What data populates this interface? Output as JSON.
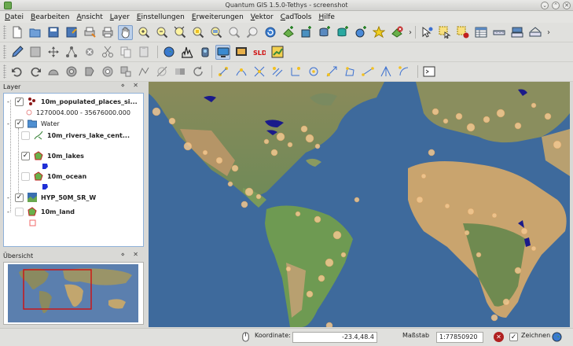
{
  "window": {
    "title": "Quantum GIS 1.5.0-Tethys - screenshot",
    "minimize_glyph": "⌄",
    "maximize_glyph": "⌃",
    "close_glyph": "✕",
    "close_button_label": "✕"
  },
  "menu": [
    {
      "label": "Datei"
    },
    {
      "label": "Bearbeiten"
    },
    {
      "label": "Ansicht"
    },
    {
      "label": "Layer"
    },
    {
      "label": "Einstellungen"
    },
    {
      "label": "Erweiterungen"
    },
    {
      "label": "Vektor"
    },
    {
      "label": "CadTools"
    },
    {
      "label": "Hilfe"
    }
  ],
  "toolbar_overflow": "›",
  "layers_panel": {
    "title": "Layer",
    "controls": "⋄ ✕",
    "items": [
      {
        "name": "10m_populated_places_si...",
        "checked": "✓",
        "icon": "point-layer-icon",
        "color": "#8b1a1a"
      },
      {
        "name": "1270004.000 - 35676000.000",
        "checked": "",
        "icon": "point-symbol-icon",
        "color": "#e89090"
      },
      {
        "name": "Water",
        "checked": "✓",
        "icon": "group-folder-icon",
        "color": "#4f8fd1"
      },
      {
        "name": "10m_rivers_lake_cent...",
        "checked": "",
        "icon": "line-layer-icon",
        "color": "#2a7a2a"
      },
      {
        "name": "10m_lakes",
        "checked": "✓",
        "icon": "polygon-layer-icon",
        "color": "#1f2fd6"
      },
      {
        "name": "10m_ocean",
        "checked": "",
        "icon": "polygon-layer-icon",
        "color": "#1f2fd6"
      },
      {
        "name": "HYP_50M_SR_W",
        "checked": "✓",
        "icon": "raster-layer-icon",
        "color": "#3a6fb0"
      },
      {
        "name": "10m_land",
        "checked": "",
        "icon": "polygon-layer-icon",
        "color": "#f06a6a"
      }
    ]
  },
  "overview_panel": {
    "title": "Übersicht",
    "controls": "⋄ ✕"
  },
  "statusbar": {
    "coord_label": "Koordinate:",
    "coord_value": "-23.4,48.4",
    "scale_label": "Maßstab",
    "scale_value": "1:77850920",
    "render_checked": "✓",
    "render_label": "Zeichnen"
  },
  "colors": {
    "ocean": "#3e6a9c",
    "land": "#7a8a5a",
    "desert": "#c9a46e",
    "places": "#f2c890",
    "lakes": "#1a1a8a",
    "overview_extent": "#d01010"
  }
}
